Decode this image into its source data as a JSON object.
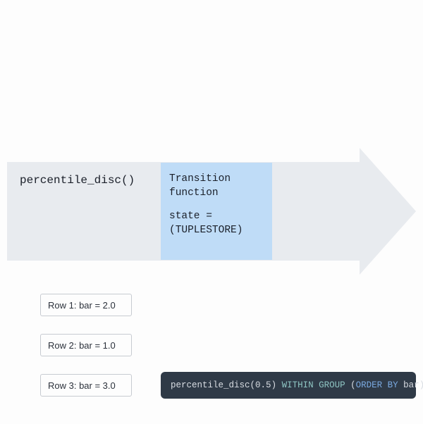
{
  "arrow": {
    "function_label": "percentile_disc()",
    "transition": {
      "title_line1": "Transition",
      "title_line2": "function",
      "state_line1": "state =",
      "state_line2": "(TUPLESTORE)"
    }
  },
  "rows": [
    {
      "label": "Row 1: bar = 2.0"
    },
    {
      "label": "Row 2: bar = 1.0"
    },
    {
      "label": "Row 3: bar = 3.0"
    }
  ],
  "code": {
    "fn": "percentile_disc",
    "open": "(",
    "arg": "0.5",
    "close": ")",
    "sp1": " ",
    "kw_within": "WITHIN GROUP",
    "sp2": " ",
    "open2": "(",
    "kw_orderby": "ORDER BY",
    "sp3": " ",
    "ident": "bar",
    "close2": ")"
  }
}
